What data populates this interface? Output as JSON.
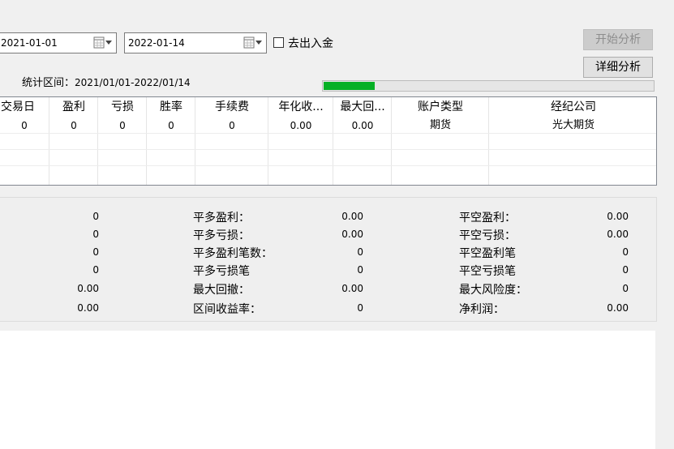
{
  "toolbar": {
    "start_date": "2021-01-01",
    "end_date": "2022-01-14",
    "cash_checkbox_label": "去出入金",
    "cash_checked": false,
    "start_analysis_label": "开始分析",
    "detail_analysis_label": "详细分析"
  },
  "range": {
    "label": "统计区间：",
    "value": "2021/01/01-2022/01/14"
  },
  "progress": {
    "percent": 16,
    "color": "#06b025"
  },
  "table": {
    "headers": [
      "交易日",
      "盈利",
      "亏损",
      "胜率",
      "手续费",
      "年化收...",
      "最大回...",
      "账户类型",
      "经纪公司"
    ],
    "rows": [
      [
        "0",
        "0",
        "0",
        "0",
        "0",
        "0.00",
        "0.00",
        "期货",
        "光大期货"
      ]
    ]
  },
  "stats": {
    "col1_values": [
      "0",
      "0",
      "0",
      "0",
      "0.00",
      "0.00"
    ],
    "col2": [
      {
        "label": "平多盈利：",
        "value": "0.00"
      },
      {
        "label": "平多亏损：",
        "value": "0.00"
      },
      {
        "label": "平多盈利笔数：",
        "value": "0"
      },
      {
        "label": "平多亏损笔",
        "value": "0"
      },
      {
        "label": "最大回撤：",
        "value": "0.00"
      },
      {
        "label": "区间收益率：",
        "value": "0"
      }
    ],
    "col3": [
      {
        "label": "平空盈利：",
        "value": "0.00"
      },
      {
        "label": "平空亏损：",
        "value": "0.00"
      },
      {
        "label": "平空盈利笔",
        "value": "0"
      },
      {
        "label": "平空亏损笔",
        "value": "0"
      },
      {
        "label": "最大风险度：",
        "value": "0"
      },
      {
        "label": "净利润：",
        "value": "0.00"
      }
    ]
  }
}
